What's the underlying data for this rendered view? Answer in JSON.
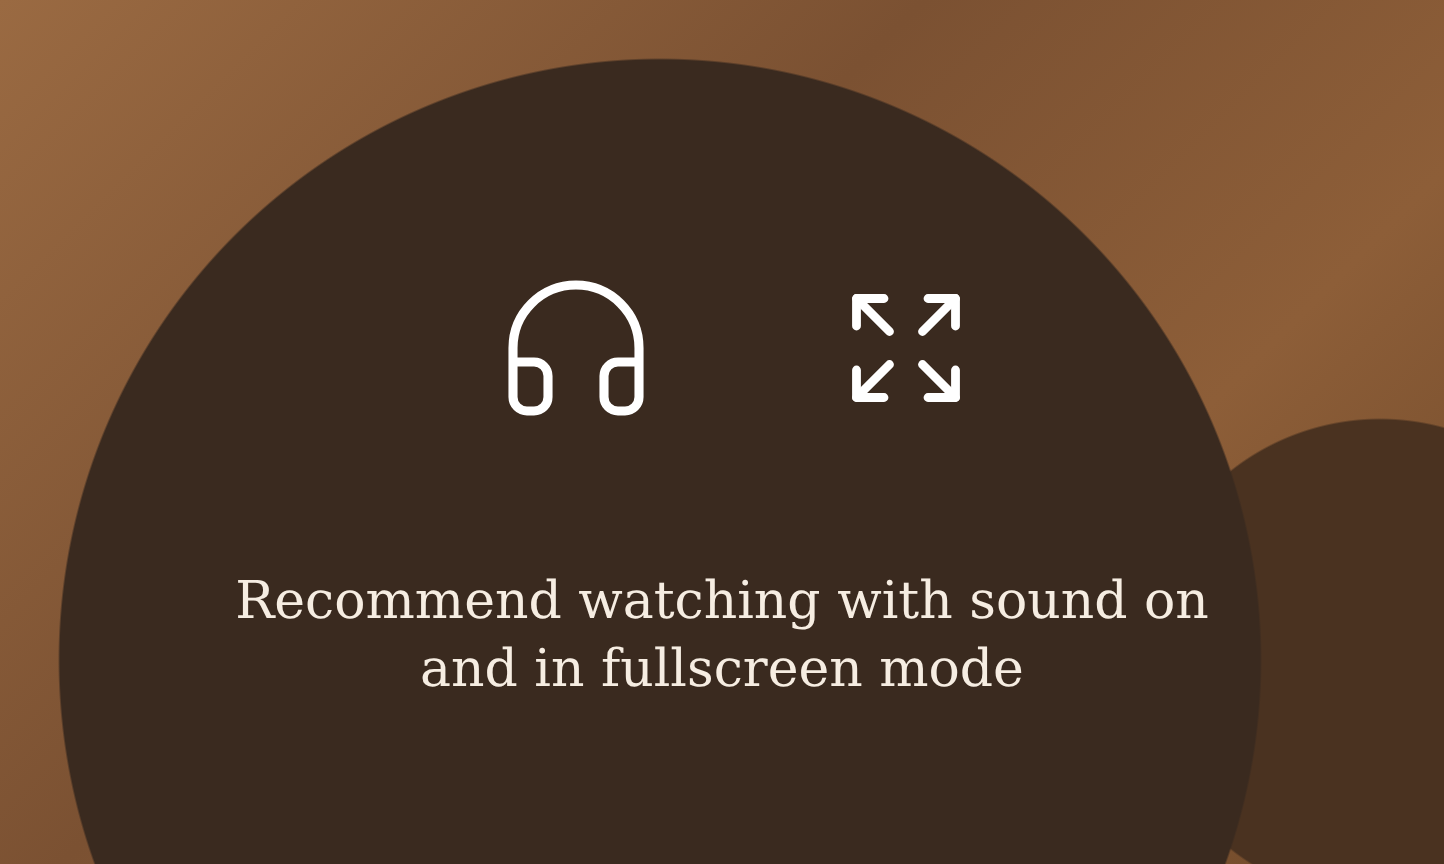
{
  "message_lines": [
    "Recommend watching with sound on",
    "and in fullscreen mode"
  ]
}
